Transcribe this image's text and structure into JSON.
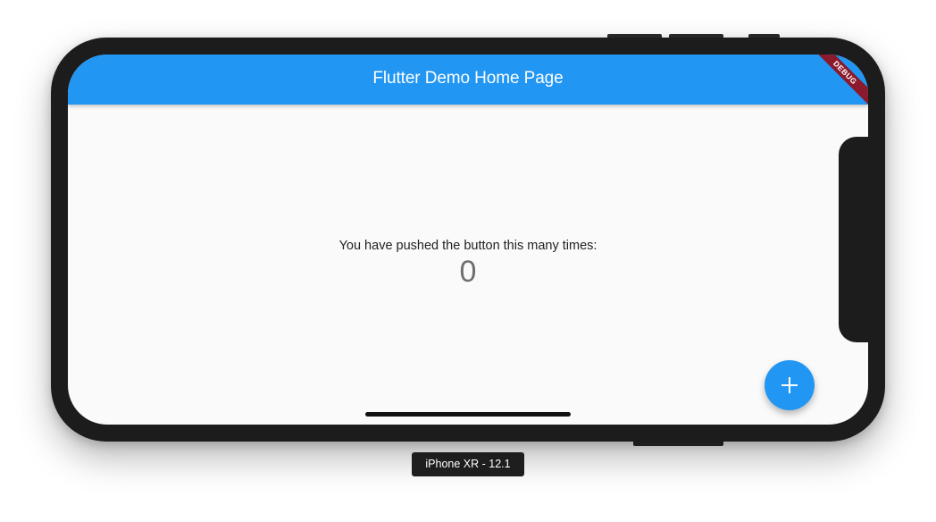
{
  "app": {
    "title": "Flutter Demo Home Page",
    "debug_banner": "DEBUG",
    "accent_color": "#2196f3"
  },
  "body": {
    "counter_label": "You have pushed the button this many times:",
    "counter_value": "0"
  },
  "fab": {
    "icon": "plus-icon",
    "symbol": "+"
  },
  "simulator": {
    "device_label": "iPhone XR - 12.1"
  }
}
